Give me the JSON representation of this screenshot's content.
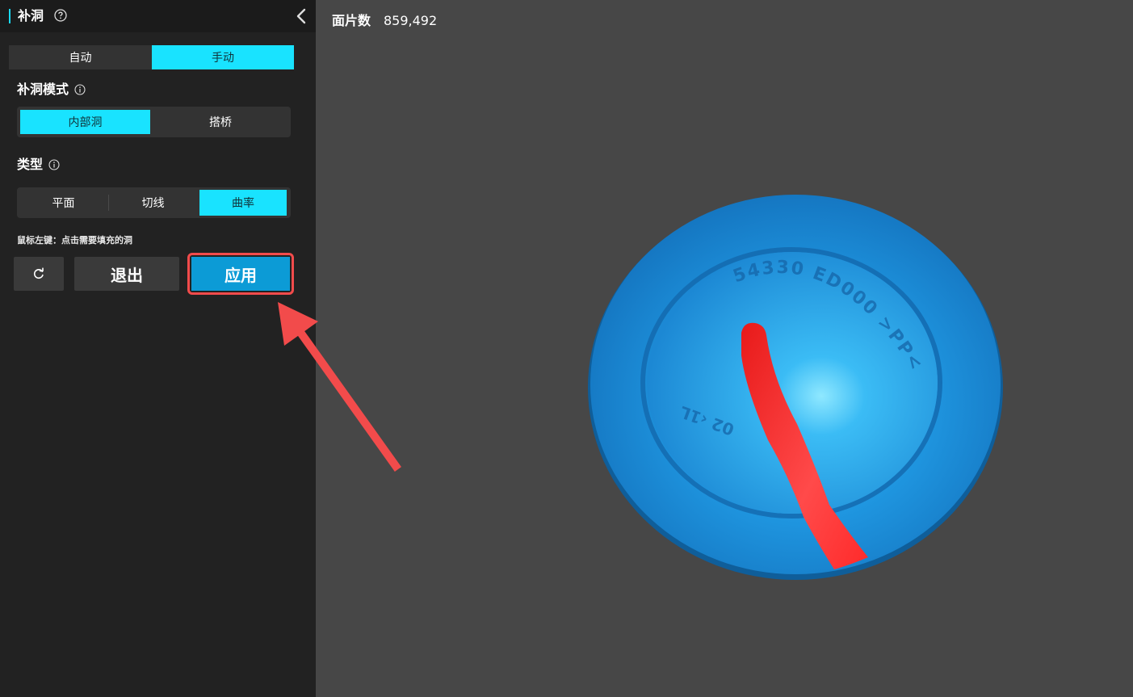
{
  "panel": {
    "title": "补洞",
    "mode_tabs": [
      {
        "label": "自动",
        "active": false
      },
      {
        "label": "手动",
        "active": true
      }
    ],
    "fill_mode": {
      "label": "补洞模式",
      "options": [
        {
          "label": "内部洞",
          "active": true
        },
        {
          "label": "搭桥",
          "active": false
        }
      ]
    },
    "type": {
      "label": "类型",
      "options": [
        {
          "label": "平面",
          "active": false
        },
        {
          "label": "切线",
          "active": false
        },
        {
          "label": "曲率",
          "active": true
        }
      ]
    },
    "hint": "鼠标左键：点击需要填充的洞",
    "buttons": {
      "reset_icon": "refresh-icon",
      "exit": "退出",
      "apply": "应用"
    }
  },
  "viewport": {
    "face_count_label": "面片数",
    "face_count_value": "859,492",
    "model_text_top": "54330 ED000 >PP<",
    "model_text_left": "02 ‹1L",
    "hole_color": "#ff2a2a",
    "model_color": "#1a8fdc"
  },
  "annotation": {
    "arrow_color": "#f24b4b",
    "highlight_color": "#f24b4b"
  },
  "colors": {
    "accent": "#19e3ff",
    "apply": "#0c9bd6",
    "panel_bg": "#222222",
    "viewport_bg": "#474747"
  }
}
